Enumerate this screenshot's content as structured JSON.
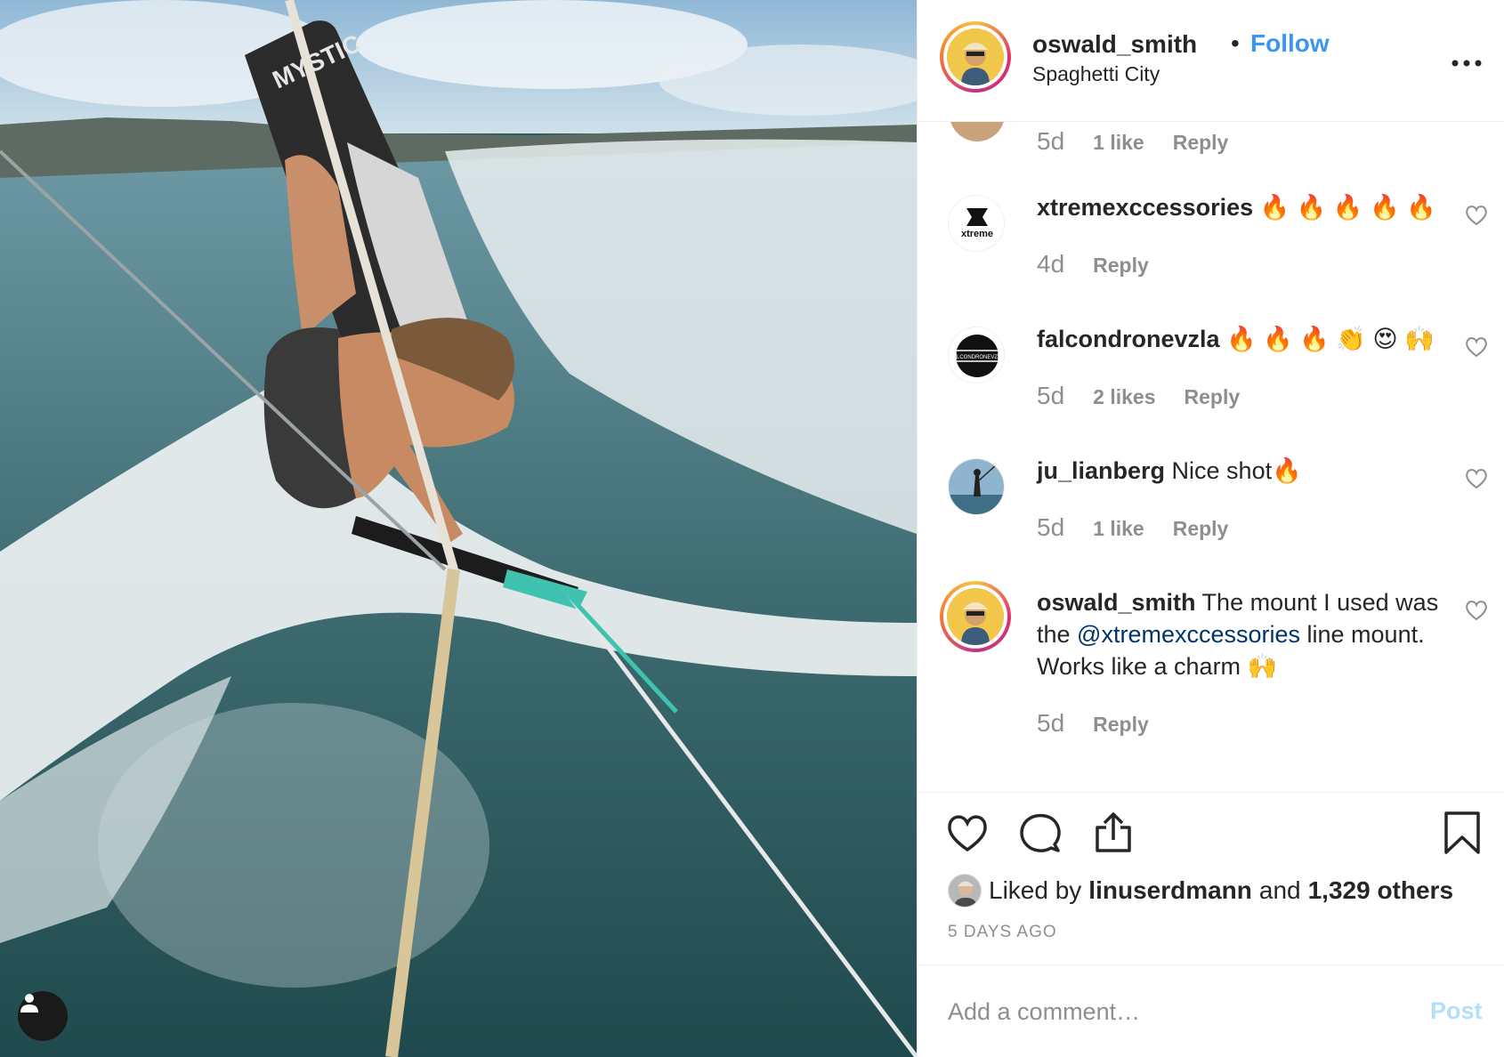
{
  "header": {
    "username": "oswald_smith",
    "separator": "•",
    "follow_label": "Follow",
    "location": "Spaghetti City",
    "more_label": "•••"
  },
  "comments": {
    "partial": {
      "time": "5d",
      "likes": "1 like",
      "reply": "Reply"
    },
    "items": [
      {
        "username": "xtremexccessories",
        "text": " 🔥 🔥 🔥 🔥 🔥",
        "time": "4d",
        "likes": "",
        "reply": "Reply",
        "avatar": "xtreme-logo"
      },
      {
        "username": "falcondronevzla",
        "text": " 🔥 🔥 🔥 👏 😍 🙌",
        "time": "5d",
        "likes": "2 likes",
        "reply": "Reply",
        "avatar": "falcon-logo"
      },
      {
        "username": "ju_lianberg",
        "text": " Nice shot🔥",
        "time": "5d",
        "likes": "1 like",
        "reply": "Reply",
        "avatar": "kitesurfer-photo"
      },
      {
        "username": "oswald_smith",
        "text_before": " The mount I used was the ",
        "mention": "@xtremexccessories",
        "text_after": " line mount. Works like a charm 🙌",
        "time": "5d",
        "likes": "",
        "reply": "Reply",
        "avatar": "author-photo"
      }
    ]
  },
  "actions": {
    "liked_by_prefix": "Liked by",
    "liked_by_user": "linuserdmann",
    "liked_and": "and",
    "others": "1,329 others",
    "age": "5 DAYS AGO"
  },
  "composer": {
    "placeholder": "Add a comment…",
    "post_label": "Post"
  },
  "colors": {
    "accent": "#3897f0",
    "mention": "#003569",
    "muted": "#8e8e8e",
    "post_disabled": "#b2dffc",
    "border": "#efefef"
  },
  "icons": [
    "heart-icon",
    "comment-icon",
    "share-icon",
    "bookmark-icon",
    "user-tag-icon",
    "more-icon"
  ]
}
